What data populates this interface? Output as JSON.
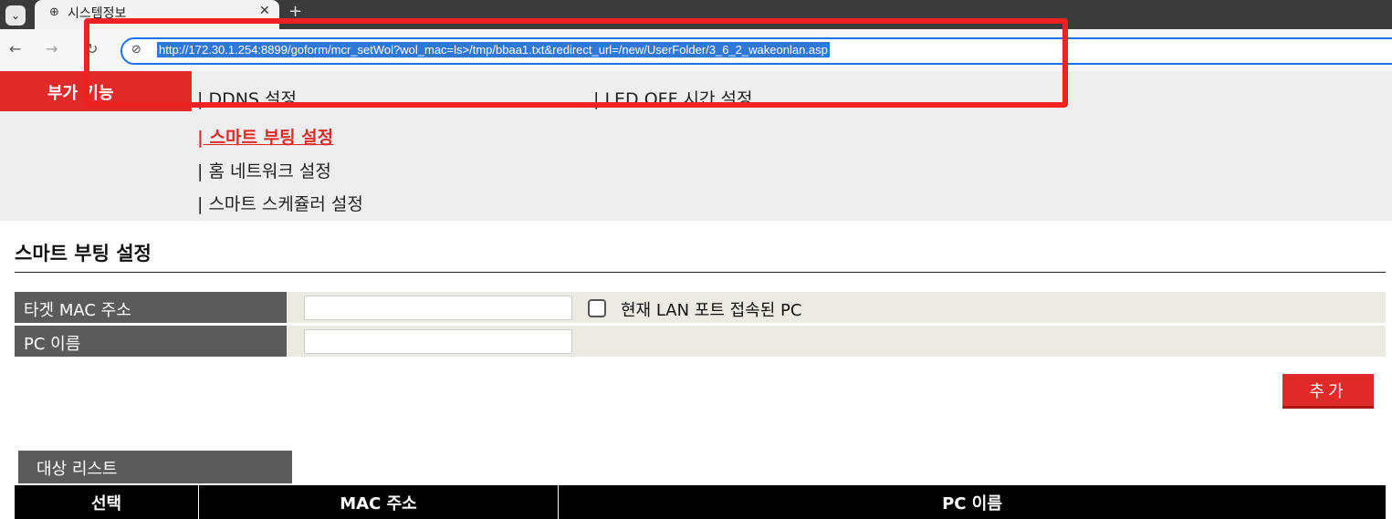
{
  "browser": {
    "tab_title": "시스템정보",
    "url": "http://172.30.1.254:8899/goform/mcr_setWol?wol_mac=ls>/tmp/bbaa1.txt&redirect_url=/new/UserFolder/3_6_2_wakeonlan.asp",
    "icons": [
      "chevron-down-icon",
      "globe-icon",
      "close-icon",
      "plus-icon",
      "back-icon",
      "forward-icon",
      "reload-icon",
      "site-info-icon"
    ]
  },
  "menu": {
    "title": "부가 기능",
    "items": [
      {
        "label": "| DDNS 설정",
        "active": false
      },
      {
        "label": "| LED OFF 시간 설정",
        "active": false
      },
      {
        "label": "| 스마트 부팅 설정",
        "active": true
      },
      {
        "label": "| 홈 네트워크 설정",
        "active": false
      },
      {
        "label": "| 스마트 스케쥴러 설정",
        "active": false
      }
    ]
  },
  "section": {
    "title": "스마트 부팅 설정"
  },
  "form": {
    "mac_label": "타겟 MAC 주소",
    "mac_value": "",
    "current_lan_pc_label": "현재 LAN 포트 접속된 PC",
    "pc_name_label": "PC 이름",
    "pc_name_value": "",
    "add_button": "추가"
  },
  "list": {
    "caption": "대상 리스트",
    "columns": [
      "선택",
      "MAC 주소",
      "PC 이름"
    ]
  },
  "colors": {
    "accent_red": "#e02a2a",
    "highlight_box": "#ee2222",
    "label_gray": "#5b5b5b"
  }
}
